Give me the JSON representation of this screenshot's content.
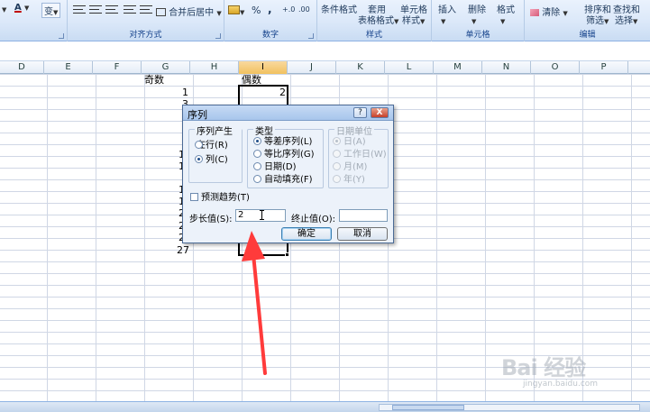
{
  "ribbon": {
    "font_group": {
      "ruby_label": "变"
    },
    "align_group": {
      "merge_center": "合并后居中",
      "label": "对齐方式"
    },
    "number_group": {
      "percent": "%",
      "comma": ",",
      "label": "数字"
    },
    "styles_group": {
      "conditional": "条件格式",
      "format_table_top": "套用",
      "format_table_bottom": "表格格式",
      "cell_styles_top": "单元格",
      "cell_styles_bottom": "样式",
      "label": "样式"
    },
    "cells_group": {
      "insert": "插入",
      "delete": "删除",
      "format": "格式",
      "label": "单元格"
    },
    "edit_group": {
      "clear": "清除",
      "sort_top": "排序和",
      "sort_bottom": "筛选",
      "find_top": "查找和",
      "find_bottom": "选择",
      "label": "编辑"
    },
    "font_color": "#c00000"
  },
  "columns": [
    "D",
    "E",
    "F",
    "G",
    "H",
    "I",
    "J",
    "K",
    "L",
    "M",
    "N",
    "O",
    "P"
  ],
  "active_column": "I",
  "cells": {
    "odd_header": "奇数",
    "even_header": "偶数",
    "g1": "1",
    "g2": "3",
    "g_a": "1",
    "g_b": "1",
    "g_c": "1",
    "g_d": "1",
    "g_e": "2",
    "g_f": "2",
    "g_g": "2",
    "g_last": "27",
    "i1": "2"
  },
  "dialog": {
    "title": "序列",
    "help": "?",
    "close": "X",
    "series_in": {
      "legend": "序列产生在",
      "rows": "行(R)",
      "columns": "列(C)",
      "selected": "columns"
    },
    "type": {
      "legend": "类型",
      "linear": "等差序列(L)",
      "growth": "等比序列(G)",
      "date": "日期(D)",
      "autofill": "自动填充(F)",
      "selected": "linear"
    },
    "date_unit": {
      "legend": "日期单位",
      "day": "日(A)",
      "weekday": "工作日(W)",
      "month": "月(M)",
      "year": "年(Y)",
      "selected": "day"
    },
    "trend": "预测趋势(T)",
    "step_label": "步长值(S):",
    "step_value": "2",
    "stop_label": "终止值(O):",
    "stop_value": "",
    "ok": "确定",
    "cancel": "取消"
  },
  "annotation": {
    "arrow_color": "#ff3b3b"
  },
  "watermark": {
    "logo": "Bai 经验",
    "url": "jingyan.baidu.com"
  }
}
